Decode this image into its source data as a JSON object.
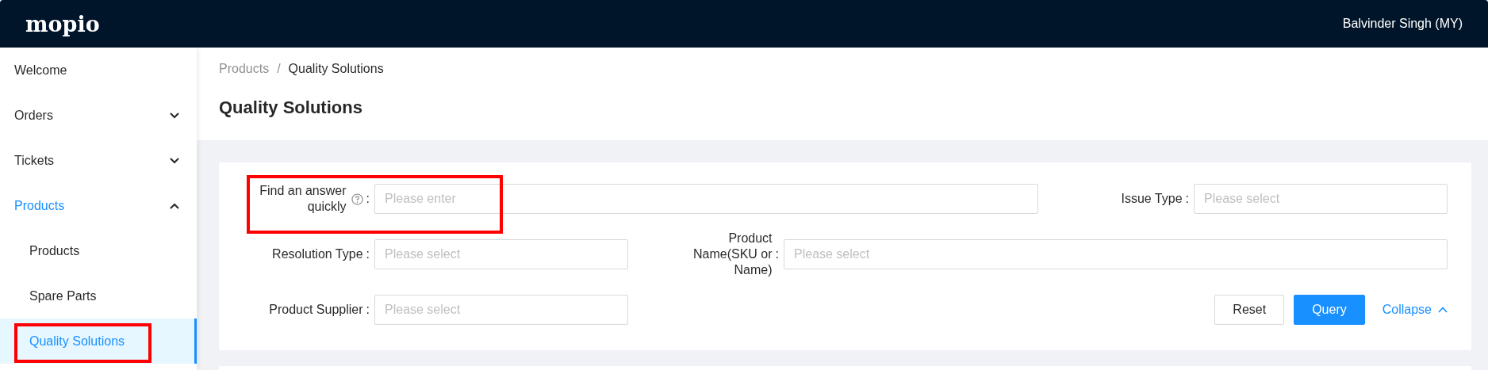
{
  "header": {
    "logo": "mopio",
    "user": "Balvinder Singh (MY)"
  },
  "sidebar": {
    "items": [
      {
        "label": "Welcome",
        "selected": false
      },
      {
        "label": "Orders",
        "selected": false,
        "expanded": false
      },
      {
        "label": "Tickets",
        "selected": false,
        "expanded": false
      },
      {
        "label": "Products",
        "selected": false,
        "expanded": true,
        "children": [
          {
            "label": "Products",
            "selected": false
          },
          {
            "label": "Spare Parts",
            "selected": false
          },
          {
            "label": "Quality Solutions",
            "selected": true
          }
        ]
      }
    ]
  },
  "breadcrumb": {
    "items": [
      "Products",
      "Quality Solutions"
    ],
    "separator": "/"
  },
  "page_title": "Quality Solutions",
  "form": {
    "rows": [
      [
        {
          "label": "Find an answer quickly",
          "help": true,
          "colon": ":",
          "placeholder": "Please enter"
        },
        {
          "label": "Issue Type",
          "help": false,
          "colon": ":",
          "placeholder": "Please select"
        }
      ],
      [
        {
          "label": "Resolution Type",
          "help": false,
          "colon": ":",
          "placeholder": "Please select"
        },
        {
          "label": "Product Name(SKU or Name)",
          "help": false,
          "colon": ":",
          "placeholder": "Please select"
        }
      ],
      [
        {
          "label": "Product Supplier",
          "help": false,
          "colon": ":",
          "placeholder": "Please select"
        }
      ]
    ],
    "buttons": [
      {
        "label": "Reset",
        "kind": "default"
      },
      {
        "label": "Query",
        "kind": "primary"
      }
    ],
    "collapse": {
      "label": "Collapse",
      "expanded": true
    }
  }
}
